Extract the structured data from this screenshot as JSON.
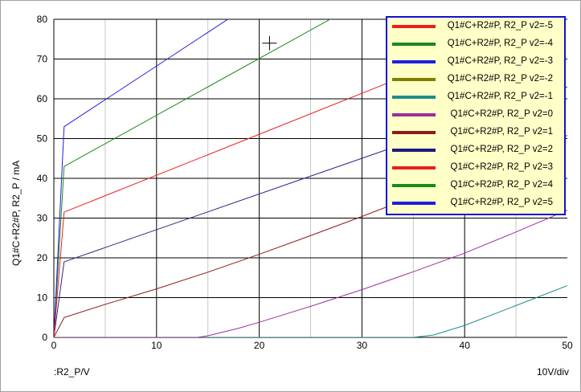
{
  "chart_data": {
    "type": "line",
    "title": "",
    "ylabel": "Q1#C+R2#P, R2_P / mA",
    "xlabel": ":R2_P/V",
    "scale_note": "10V/div",
    "xlim": [
      0,
      50
    ],
    "ylim": [
      0,
      80
    ],
    "xticks": [
      "0",
      "10",
      "20",
      "30",
      "40",
      "50"
    ],
    "yticks": [
      "0",
      "10",
      "20",
      "30",
      "40",
      "50",
      "60",
      "70",
      "80"
    ],
    "grid": true,
    "legend_position": "top-right",
    "series": [
      {
        "name": "Q1#C+R2#P, R2_P v2=-5",
        "color": "#e82020",
        "points": [
          [
            0,
            0
          ],
          [
            1,
            31.5
          ],
          [
            50,
            90
          ]
        ],
        "visible": false
      },
      {
        "name": "Q1#C+R2#P, R2_P v2=-4",
        "color": "#1a8a1a",
        "points": [
          [
            0,
            0
          ],
          [
            1,
            43
          ],
          [
            50,
            113
          ]
        ]
      },
      {
        "name": "Q1#C+R2#P, R2_P v2=-3",
        "color": "#2020e0",
        "points": [
          [
            0,
            0
          ],
          [
            1,
            53
          ],
          [
            50,
            136
          ]
        ]
      },
      {
        "name": "Q1#C+R2#P, R2_P v2=-2",
        "color": "#808000",
        "points": [],
        "visible": false
      },
      {
        "name": "Q1#C+R2#P, R2_P v2=-1",
        "color": "#1e8c8c",
        "points": [
          [
            0,
            0
          ],
          [
            35,
            0
          ],
          [
            37,
            0.6
          ],
          [
            40,
            3
          ],
          [
            45,
            8
          ],
          [
            50,
            13
          ]
        ]
      },
      {
        "name": "Q1#C+R2#P, R2_P v2=0",
        "color": "#9a309a",
        "points": [
          [
            0,
            0
          ],
          [
            14,
            0
          ],
          [
            15,
            0.4
          ],
          [
            18,
            2.3
          ],
          [
            20,
            3.8
          ],
          [
            25,
            7.8
          ],
          [
            30,
            12
          ],
          [
            35,
            16.5
          ],
          [
            40,
            21.2
          ],
          [
            45,
            26.5
          ],
          [
            50,
            32
          ]
        ]
      },
      {
        "name": "Q1#C+R2#P, R2_P v2=1",
        "color": "#8b1a1a",
        "points": [
          [
            0,
            0
          ],
          [
            1,
            5
          ],
          [
            5,
            8.3
          ],
          [
            10,
            12.2
          ],
          [
            15,
            16.4
          ],
          [
            20,
            20.9
          ],
          [
            25,
            25.6
          ],
          [
            30,
            30.4
          ],
          [
            35,
            35.4
          ],
          [
            40,
            40.4
          ],
          [
            45,
            45.6
          ],
          [
            50,
            50.8
          ]
        ]
      },
      {
        "name": "Q1#C+R2#P, R2_P v2=2",
        "color": "#2a2a80",
        "points": [
          [
            0,
            0
          ],
          [
            1,
            19
          ],
          [
            50,
            63
          ]
        ]
      },
      {
        "name": "Q1#C+R2#P, R2_P v2=3",
        "color": "#e82020",
        "points": [
          [
            0,
            0
          ],
          [
            1,
            31.5
          ],
          [
            50,
            82
          ]
        ]
      },
      {
        "name": "Q1#C+R2#P, R2_P v2=4",
        "color": "#1a8a1a",
        "points": [],
        "visible": false
      },
      {
        "name": "Q1#C+R2#P, R2_P v2=5",
        "color": "#2020e0",
        "points": [],
        "visible": false
      }
    ],
    "legend_colors": [
      "#e82020",
      "#1a8a1a",
      "#2020e0",
      "#808000",
      "#1e8c8c",
      "#9a309a",
      "#8b1a1a",
      "#1a1a80",
      "#e82020",
      "#1a8a1a",
      "#2020e0"
    ],
    "cursor": {
      "x": 21,
      "y": 74
    }
  }
}
